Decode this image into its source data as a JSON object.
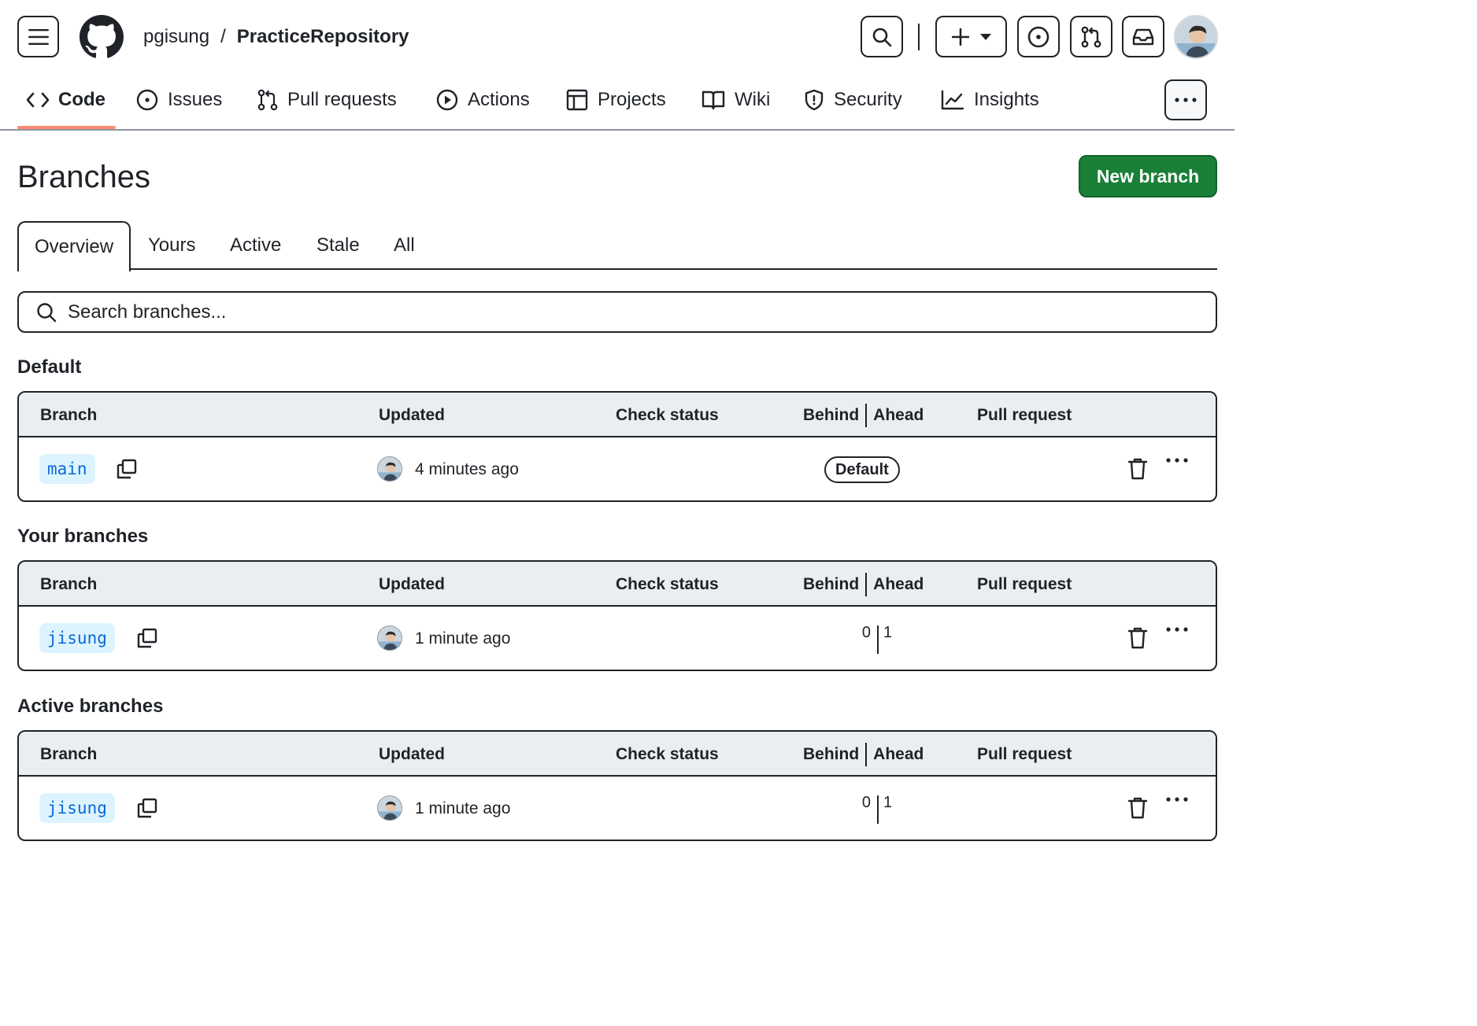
{
  "header": {
    "owner": "pgisung",
    "separator": "/",
    "repo": "PracticeRepository"
  },
  "nav": {
    "items": [
      {
        "label": "Code",
        "icon": "code-icon"
      },
      {
        "label": "Issues",
        "icon": "issue-icon"
      },
      {
        "label": "Pull requests",
        "icon": "pull-request-icon"
      },
      {
        "label": "Actions",
        "icon": "play-icon"
      },
      {
        "label": "Projects",
        "icon": "table-icon"
      },
      {
        "label": "Wiki",
        "icon": "book-icon"
      },
      {
        "label": "Security",
        "icon": "shield-icon"
      },
      {
        "label": "Insights",
        "icon": "graph-icon"
      }
    ],
    "selected": "Code"
  },
  "page": {
    "title": "Branches",
    "new_branch_label": "New branch"
  },
  "tabs": [
    "Overview",
    "Yours",
    "Active",
    "Stale",
    "All"
  ],
  "search": {
    "placeholder": "Search branches..."
  },
  "columns": {
    "branch": "Branch",
    "updated": "Updated",
    "check_status": "Check status",
    "behind": "Behind",
    "ahead": "Ahead",
    "pull_request": "Pull request"
  },
  "sections": [
    {
      "title": "Default",
      "rows": [
        {
          "branch": "main",
          "updated": "4 minutes ago",
          "badge": "Default"
        }
      ]
    },
    {
      "title": "Your branches",
      "rows": [
        {
          "branch": "jisung",
          "updated": "1 minute ago",
          "behind": "0",
          "ahead": "1"
        }
      ]
    },
    {
      "title": "Active branches",
      "rows": [
        {
          "branch": "jisung",
          "updated": "1 minute ago",
          "behind": "0",
          "ahead": "1"
        }
      ]
    }
  ],
  "colors": {
    "primary_button": "#1a7f37",
    "nav_underline": "#fd8c73",
    "branch_tag_bg": "#ddf4ff",
    "branch_tag_text": "#0969da",
    "table_header_bg": "#eaeef2"
  }
}
